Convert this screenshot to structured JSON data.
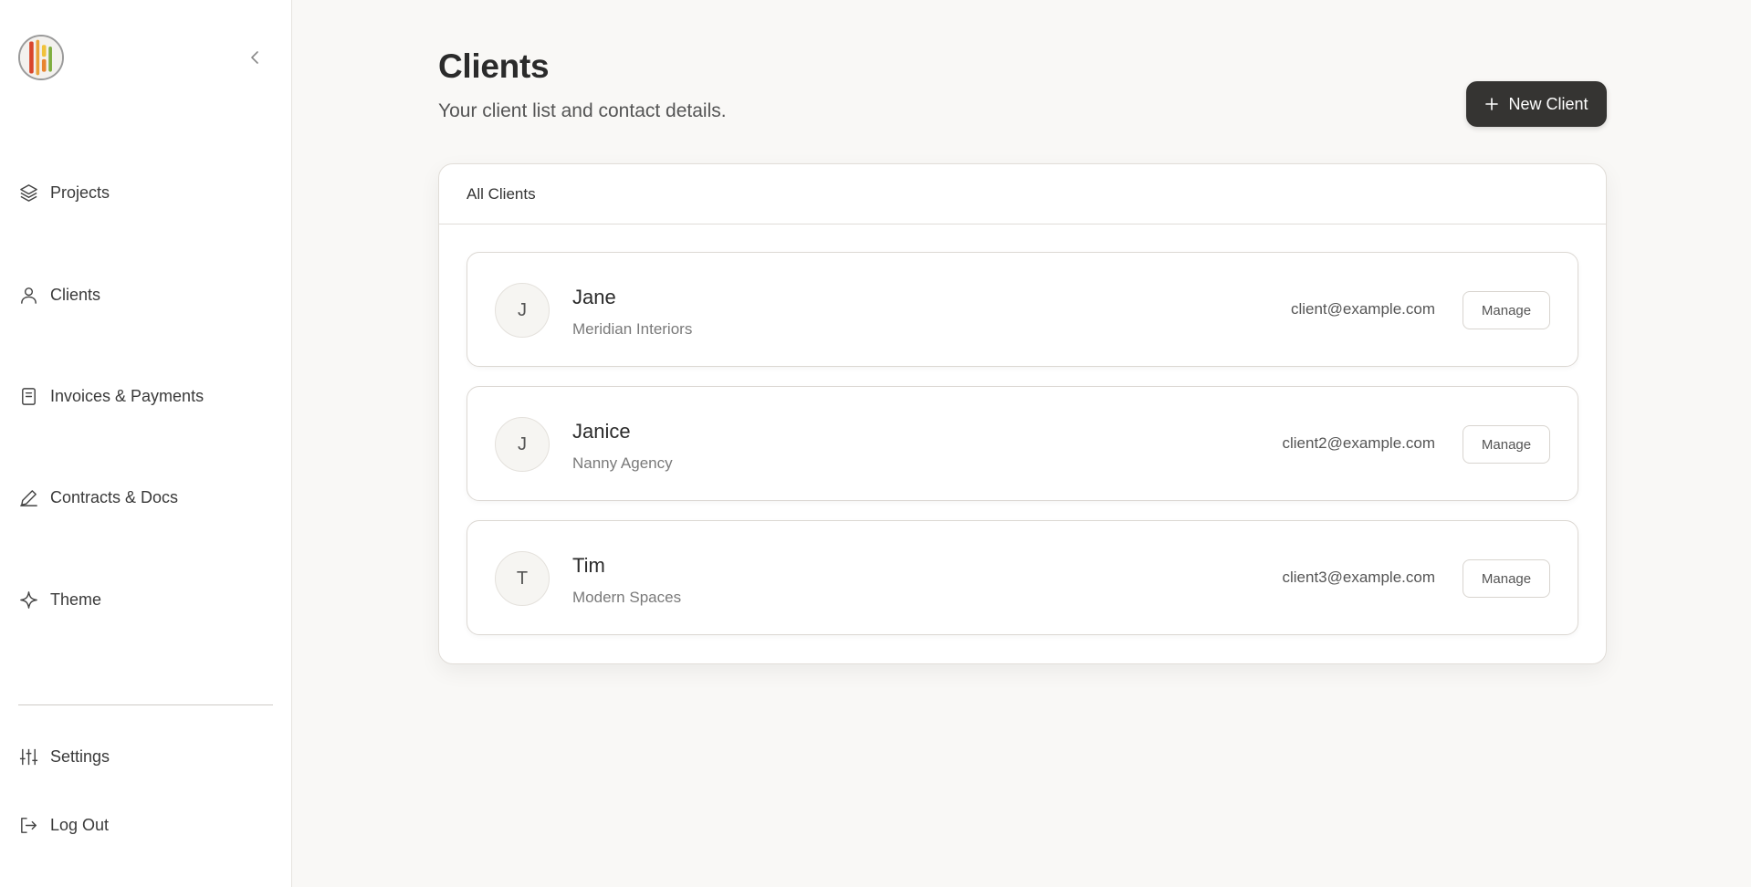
{
  "sidebar": {
    "nav": [
      {
        "label": "Projects",
        "icon": "layers-icon"
      },
      {
        "label": "Clients",
        "icon": "user-icon"
      },
      {
        "label": "Invoices & Payments",
        "icon": "receipt-icon"
      },
      {
        "label": "Contracts & Docs",
        "icon": "pen-icon"
      },
      {
        "label": "Theme",
        "icon": "sparkle-icon"
      }
    ],
    "bottom": [
      {
        "label": "Settings",
        "icon": "sliders-icon"
      },
      {
        "label": "Log Out",
        "icon": "logout-icon"
      }
    ]
  },
  "header": {
    "title": "Clients",
    "subtitle": "Your client list and contact details.",
    "new_client_label": "New Client"
  },
  "clients_card": {
    "title": "All Clients",
    "manage_label": "Manage",
    "clients": [
      {
        "initial": "J",
        "name": "Jane",
        "company": "Meridian Interiors",
        "email": "client@example.com"
      },
      {
        "initial": "J",
        "name": "Janice",
        "company": "Nanny Agency",
        "email": "client2@example.com"
      },
      {
        "initial": "T",
        "name": "Tim",
        "company": "Modern Spaces",
        "email": "client3@example.com"
      }
    ]
  },
  "colors": {
    "accent_button": "#353432",
    "background": "#f9f8f6",
    "sidebar": "#ffffff"
  }
}
